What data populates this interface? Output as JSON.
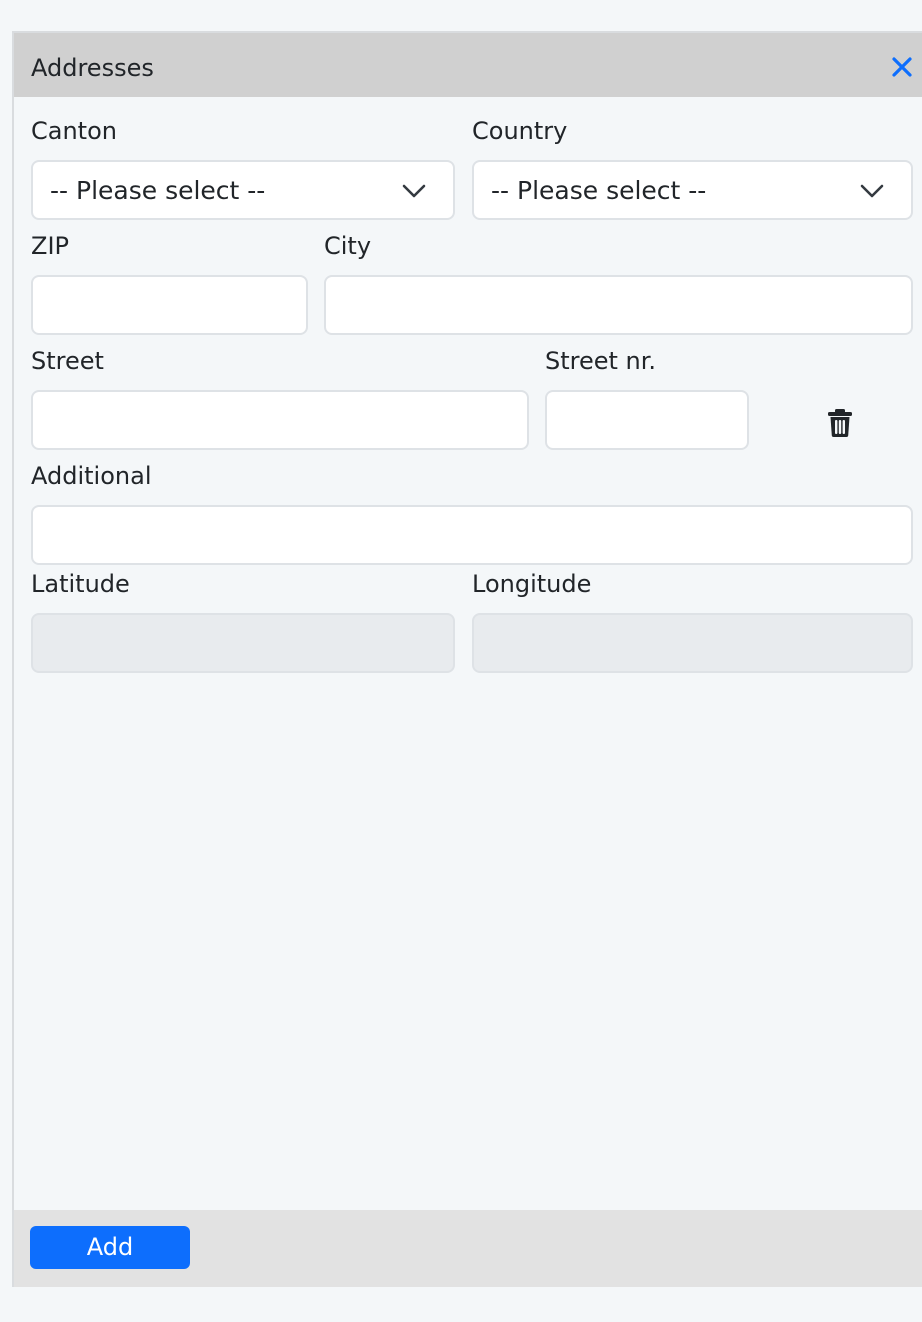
{
  "panel": {
    "title": "Addresses"
  },
  "icons": {
    "close": "close-icon",
    "chevron": "chevron-down-icon",
    "trash": "trash-icon"
  },
  "colors": {
    "accent": "#0d6efd",
    "header_bg": "#d0d0d0",
    "footer_bg": "#e2e2e2",
    "disabled_field_bg": "#e8ebee"
  },
  "form": {
    "canton": {
      "label": "Canton",
      "selected": "-- Please select --"
    },
    "country": {
      "label": "Country",
      "selected": "-- Please select --"
    },
    "zip": {
      "label": "ZIP",
      "value": ""
    },
    "city": {
      "label": "City",
      "value": ""
    },
    "street": {
      "label": "Street",
      "value": ""
    },
    "street_nr": {
      "label": "Street nr.",
      "value": ""
    },
    "additional": {
      "label": "Additional",
      "value": ""
    },
    "latitude": {
      "label": "Latitude",
      "value": ""
    },
    "longitude": {
      "label": "Longitude",
      "value": ""
    }
  },
  "footer": {
    "add_label": "Add"
  }
}
